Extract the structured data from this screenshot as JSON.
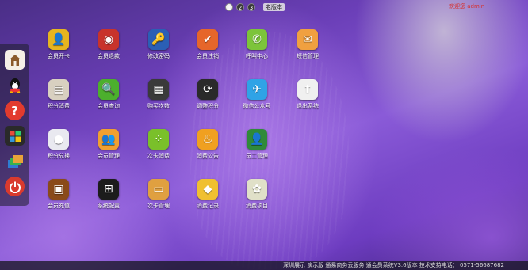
{
  "header": {
    "pages": [
      "1",
      "2",
      "3"
    ],
    "old_version_label": "老版本",
    "top_right": "欢迎您 admin"
  },
  "sidebar": [
    {
      "name": "home-icon",
      "color": "#f5f0e6"
    },
    {
      "name": "qq-icon",
      "color": "#1f1f1f"
    },
    {
      "name": "help-icon",
      "color": "#e23b2e"
    },
    {
      "name": "windows-icon",
      "color": "#3a3a3a"
    },
    {
      "name": "layers-icon",
      "color": "#3aa0d8"
    },
    {
      "name": "power-icon",
      "color": "#d93a2e"
    }
  ],
  "apps": [
    {
      "label": "会员开卡",
      "icon": "member-card-icon",
      "color": "#e6b520",
      "glyph": "👤"
    },
    {
      "label": "会员退款",
      "icon": "member-refund-icon",
      "color": "#c8332b",
      "glyph": "◉"
    },
    {
      "label": "修改密码",
      "icon": "key-icon",
      "color": "#2b5fb5",
      "glyph": "🔑"
    },
    {
      "label": "会员注销",
      "icon": "cancel-member-icon",
      "color": "#e6662a",
      "glyph": "✔"
    },
    {
      "label": "呼叫中心",
      "icon": "phone-icon",
      "color": "#7cc43a",
      "glyph": "✆"
    },
    {
      "label": "短信管理",
      "icon": "sms-icon",
      "color": "#f0a040",
      "glyph": "✉"
    },
    {
      "label": "积分消费",
      "icon": "points-spend-icon",
      "color": "#d8d0c0",
      "glyph": "▤"
    },
    {
      "label": "会员查询",
      "icon": "member-search-icon",
      "color": "#4caf2d",
      "glyph": "🔍"
    },
    {
      "label": "购买次数",
      "icon": "buy-times-icon",
      "color": "#3a3a3a",
      "glyph": "▦"
    },
    {
      "label": "调整积分",
      "icon": "adjust-points-icon",
      "color": "#2a2a2a",
      "glyph": "⟳"
    },
    {
      "label": "微信公众号",
      "icon": "wechat-icon",
      "color": "#2fa3e6",
      "glyph": "✈"
    },
    {
      "label": "退出系统",
      "icon": "exit-icon",
      "color": "#f0f0f0",
      "glyph": "⬆"
    },
    {
      "label": "积分兑换",
      "icon": "points-exchange-icon",
      "color": "#e9e9f0",
      "glyph": "●"
    },
    {
      "label": "会员管理",
      "icon": "member-manage-icon",
      "color": "#f0a030",
      "glyph": "👥"
    },
    {
      "label": "次卡消费",
      "icon": "times-card-icon",
      "color": "#7ac02a",
      "glyph": "⁘"
    },
    {
      "label": "消费公告",
      "icon": "notice-icon",
      "color": "#f0a020",
      "glyph": "♨"
    },
    {
      "label": "员工管理",
      "icon": "staff-icon",
      "color": "#2f8a3a",
      "glyph": "👤"
    },
    {
      "label": "会员充值",
      "icon": "recharge-icon",
      "color": "#8a4a1a",
      "glyph": "▣"
    },
    {
      "label": "系统配置",
      "icon": "settings-icon",
      "color": "#1c1c1c",
      "glyph": "⊞"
    },
    {
      "label": "次卡管理",
      "icon": "times-card-manage-icon",
      "color": "#e0a040",
      "glyph": "▭"
    },
    {
      "label": "消费记录",
      "icon": "records-icon",
      "color": "#f0c030",
      "glyph": "◆"
    },
    {
      "label": "消费项目",
      "icon": "items-icon",
      "color": "#e0e0c8",
      "glyph": "✿"
    }
  ],
  "footer": {
    "text": "深圳展示 演示版 通易商务云服务 通会员系统V3.6版本 技术支持电话： 0571-56687682"
  }
}
